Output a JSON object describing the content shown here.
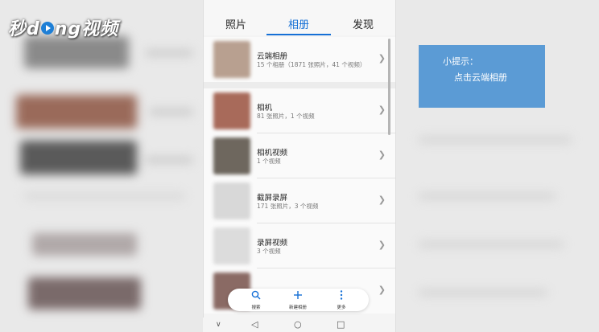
{
  "logo": {
    "part1": "秒",
    "part2": "d",
    "part3": "ng视频"
  },
  "tabs": [
    {
      "label": "照片",
      "active": false
    },
    {
      "label": "相册",
      "active": true
    },
    {
      "label": "发现",
      "active": false
    }
  ],
  "albums": [
    {
      "title": "云端相册",
      "subtitle": "15 个相册（1871 张照片，41 个视频）"
    },
    {
      "title": "相机",
      "subtitle": "81 张照片，1 个视频"
    },
    {
      "title": "相机视频",
      "subtitle": "1 个视频"
    },
    {
      "title": "截屏录屏",
      "subtitle": "171 张照片，3 个视频"
    },
    {
      "title": "录屏视频",
      "subtitle": "3 个视频"
    }
  ],
  "toolbar": {
    "search_label": "搜索",
    "new_album_label": "新建相册",
    "more_label": "更多"
  },
  "tip": {
    "title": "小提示：",
    "text": "点击云端相册"
  },
  "colors": {
    "accent": "#1670d6",
    "tip_bg": "#5b9bd5"
  },
  "icons": [
    "search-icon",
    "plus-icon",
    "more-vertical-icon",
    "chevron-right-icon",
    "back-icon",
    "home-icon",
    "recents-icon",
    "chevron-down-icon"
  ]
}
